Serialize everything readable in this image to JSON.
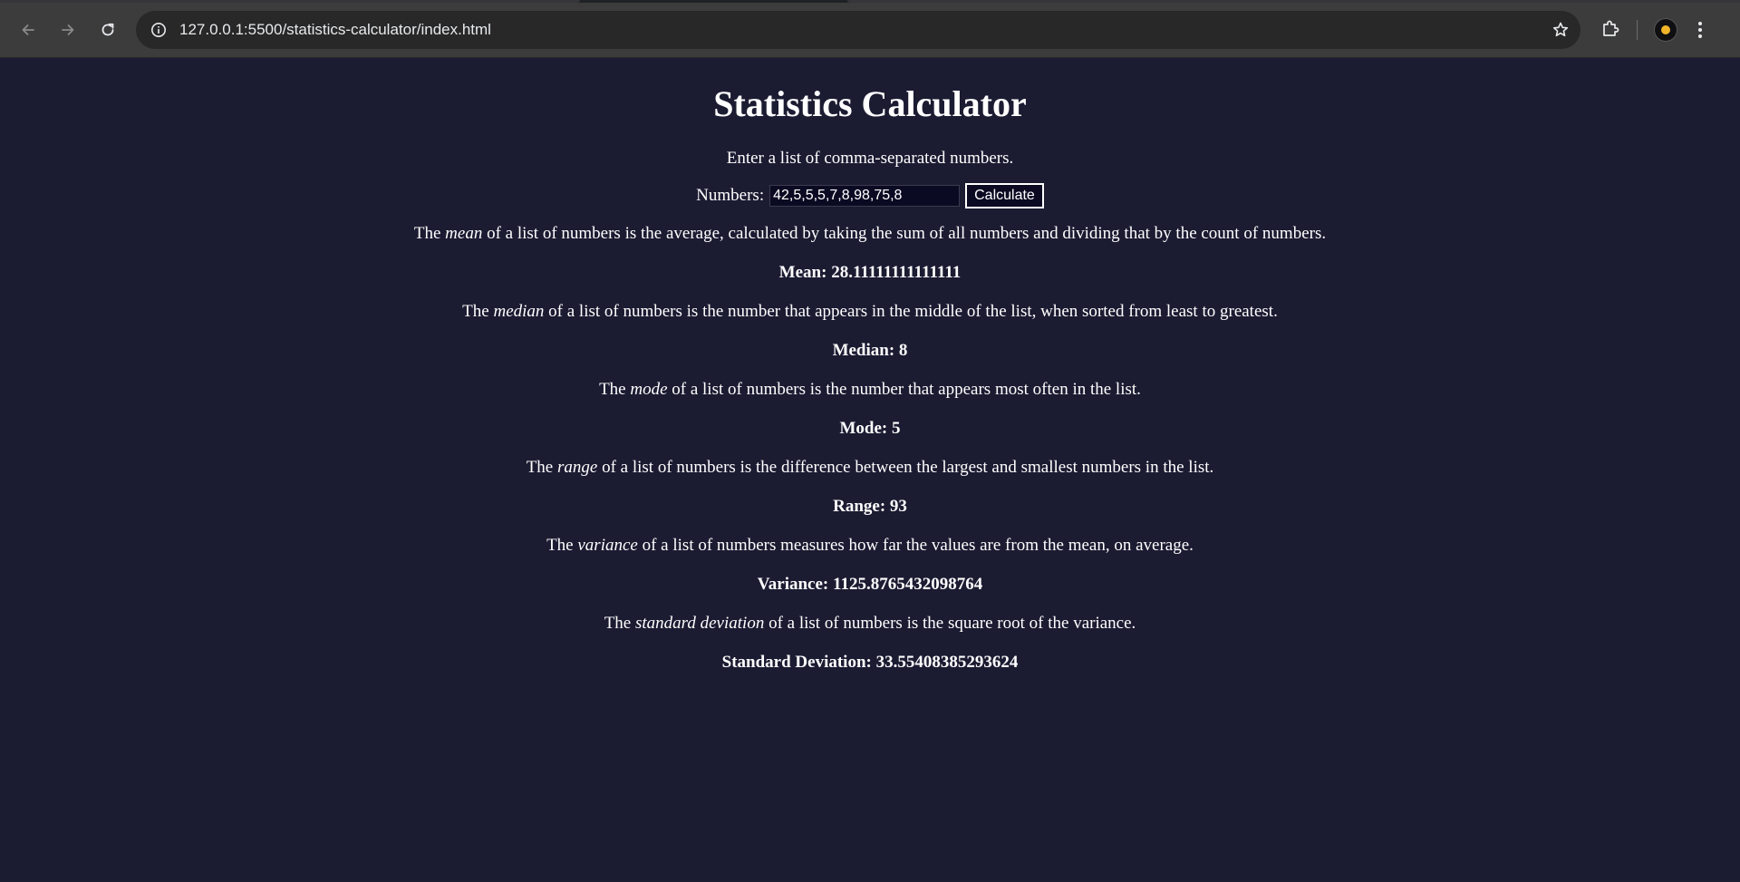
{
  "browser": {
    "url": "127.0.0.1:5500/statistics-calculator/index.html"
  },
  "page": {
    "title": "Statistics Calculator",
    "intro": "Enter a list of comma-separated numbers.",
    "form": {
      "label": "Numbers:",
      "value": "42,5,5,5,7,8,98,75,8",
      "button_label": "Calculate"
    },
    "sections": {
      "mean": {
        "pre": "The ",
        "term": "mean",
        "post": " of a list of numbers is the average, calculated by taking the sum of all numbers and dividing that by the count of numbers.",
        "result_label": "Mean: ",
        "result_value": "28.11111111111111"
      },
      "median": {
        "pre": "The ",
        "term": "median",
        "post": " of a list of numbers is the number that appears in the middle of the list, when sorted from least to greatest.",
        "result_label": "Median: ",
        "result_value": "8"
      },
      "mode": {
        "pre": "The ",
        "term": "mode",
        "post": " of a list of numbers is the number that appears most often in the list.",
        "result_label": "Mode: ",
        "result_value": "5"
      },
      "range": {
        "pre": "The ",
        "term": "range",
        "post": " of a list of numbers is the difference between the largest and smallest numbers in the list.",
        "result_label": "Range: ",
        "result_value": "93"
      },
      "variance": {
        "pre": "The ",
        "term": "variance",
        "post": " of a list of numbers measures how far the values are from the mean, on average.",
        "result_label": "Variance: ",
        "result_value": "1125.8765432098764"
      },
      "stddev": {
        "pre": "The ",
        "term": "standard deviation",
        "post": " of a list of numbers is the square root of the variance.",
        "result_label": "Standard Deviation: ",
        "result_value": "33.55408385293624"
      }
    }
  },
  "colors": {
    "page_background": "#1b1b32",
    "text": "#ffffff",
    "input_background": "#0a0a23",
    "toolbar": "#3c3c3c",
    "omnibox": "#282828"
  },
  "icons": {
    "back": "arrow-left-icon",
    "forward": "arrow-right-icon",
    "reload": "reload-icon",
    "site_info": "info-icon",
    "bookmark": "star-icon",
    "extensions": "puzzle-icon",
    "profile": "avatar",
    "menu": "kebab-menu-icon"
  }
}
